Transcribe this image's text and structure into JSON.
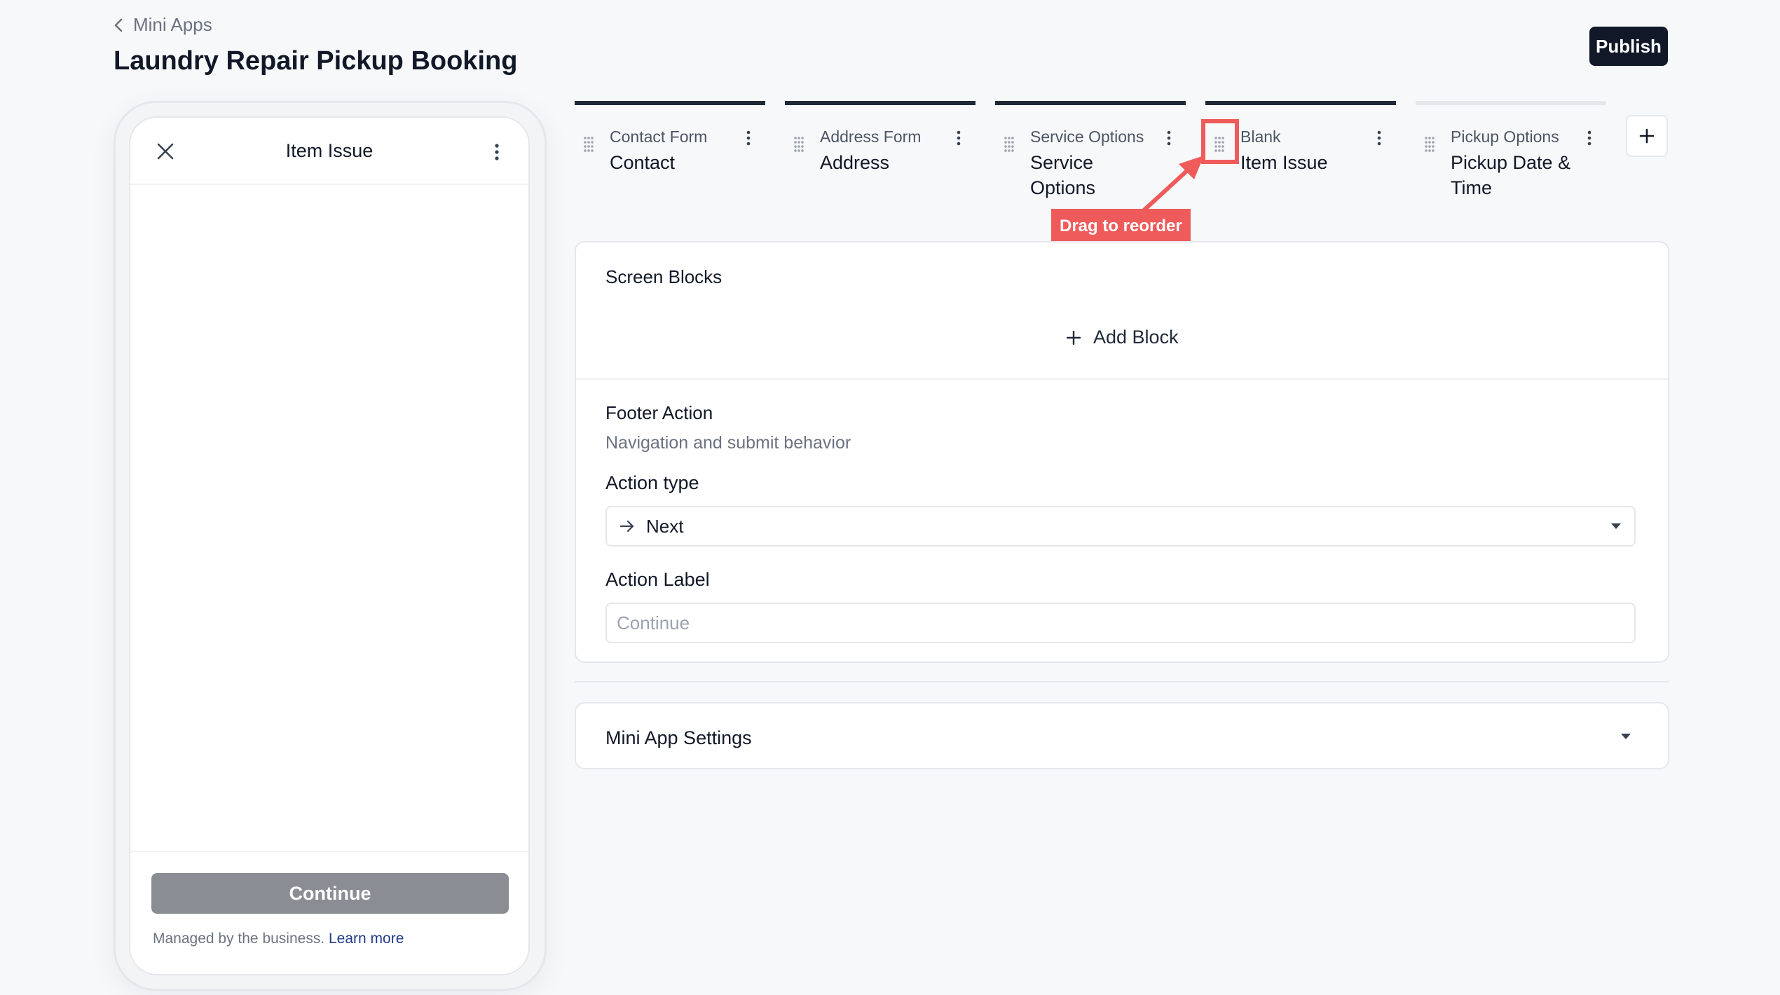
{
  "header": {
    "breadcrumb": "Mini Apps",
    "title": "Laundry Repair Pickup Booking",
    "publish_label": "Publish"
  },
  "preview": {
    "title": "Item Issue",
    "continue_label": "Continue",
    "managed_text": "Managed by the business. ",
    "learn_more": "Learn more"
  },
  "tabs": [
    {
      "type": "Contact Form",
      "name": "Contact",
      "active": true
    },
    {
      "type": "Address Form",
      "name": "Address",
      "active": true
    },
    {
      "type": "Service Options",
      "name": "Service Options",
      "active": true
    },
    {
      "type": "Blank",
      "name": "Item Issue",
      "active": true
    },
    {
      "type": "Pickup Options",
      "name": "Pickup Date & Time",
      "active": false
    }
  ],
  "annotation": {
    "label": "Drag to reorder",
    "color": "#ef5b5b"
  },
  "editor": {
    "screen_blocks_title": "Screen Blocks",
    "add_block_label": "Add Block",
    "footer_title": "Footer Action",
    "footer_subtitle": "Navigation and submit behavior",
    "action_type_label": "Action type",
    "action_type_value": "Next",
    "action_label_label": "Action Label",
    "action_label_placeholder": "Continue"
  },
  "settings": {
    "title": "Mini App Settings"
  },
  "icons": {
    "back": "chevron-left-icon",
    "close": "close-icon",
    "more": "kebab-icon",
    "grip": "drag-handle-icon",
    "add": "plus-icon",
    "arrow": "arrow-right-icon",
    "caret": "caret-down-icon"
  },
  "colors": {
    "primary_dark": "#111827",
    "annotation": "#ef5b5b",
    "disabled_button": "#8a8d94",
    "link": "#1e3a8a"
  }
}
